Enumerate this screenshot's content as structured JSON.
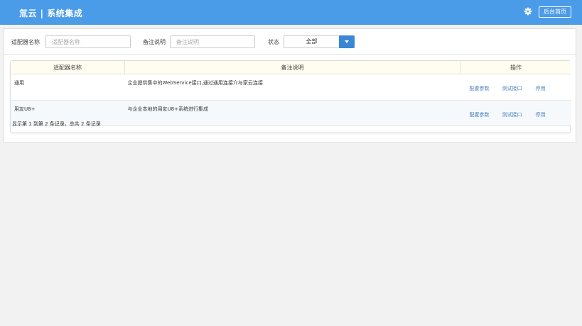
{
  "header": {
    "title": "氚云 | 系统集成",
    "admin_button": "后台首页",
    "icon": "gear-icon",
    "bg_color": "#4a9be8"
  },
  "filters": {
    "adapter_name_label": "适配器名称",
    "adapter_name_placeholder": "适配器名称",
    "remark_label": "备注说明",
    "remark_placeholder": "备注说明",
    "status_label": "状态",
    "status_value": "全部"
  },
  "table": {
    "columns": [
      "适配器名称",
      "备注说明",
      "操作"
    ],
    "rows": [
      {
        "name": "通用",
        "desc": "企业提供集中的WebService接口,通过通用连接介与家云连接",
        "ops": [
          "配置参数",
          "测试接口",
          "停用"
        ]
      },
      {
        "name": "用友U8+",
        "desc": "与企业本地的用友U8+系统进行集成",
        "ops": [
          "配置参数",
          "测试接口",
          "停用"
        ]
      }
    ],
    "summary": "显示第 1 到第 2 条记录，总共 2 条记录",
    "link_color": "#4a7fbf"
  }
}
